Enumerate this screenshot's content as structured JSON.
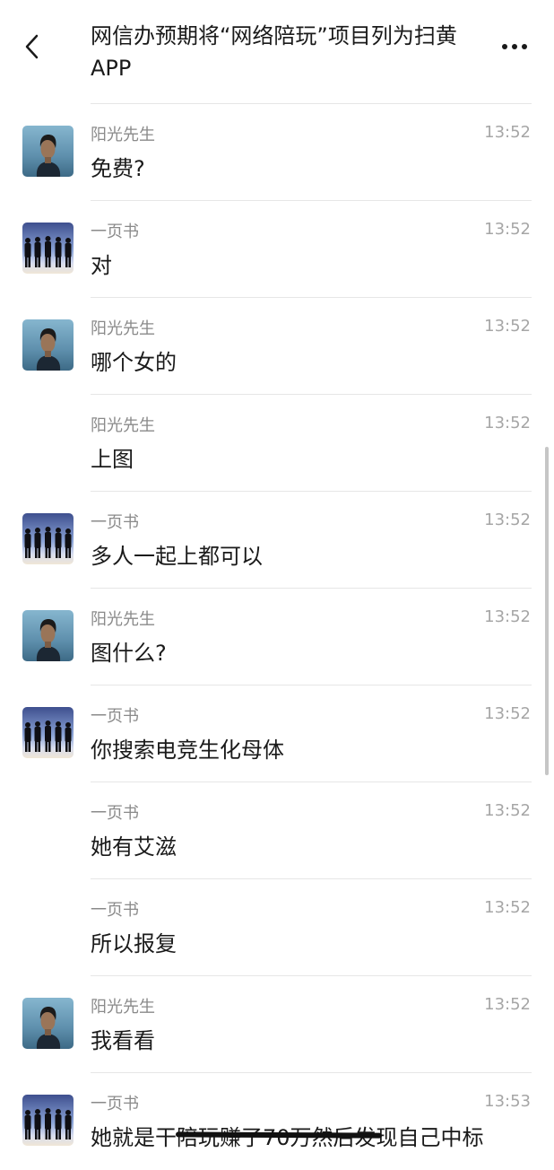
{
  "header": {
    "back_icon": "chevron-left-icon",
    "title": "网信办预期将“网络陪玩”项目列为扫黄APP",
    "more_icon": "more-horizontal-icon"
  },
  "messages": [
    {
      "sender": "阳光先生",
      "time": "13:52",
      "text": "免费?",
      "avatar": "man-avatar"
    },
    {
      "sender": "一页书",
      "time": "13:52",
      "text": "对",
      "avatar": "silhouettes-avatar"
    },
    {
      "sender": "阳光先生",
      "time": "13:52",
      "text": "哪个女的",
      "avatar": "man-avatar"
    },
    {
      "sender": "阳光先生",
      "time": "13:52",
      "text": "上图",
      "avatar": ""
    },
    {
      "sender": "一页书",
      "time": "13:52",
      "text": "多人一起上都可以",
      "avatar": "silhouettes-avatar"
    },
    {
      "sender": "阳光先生",
      "time": "13:52",
      "text": "图什么?",
      "avatar": "man-avatar"
    },
    {
      "sender": "一页书",
      "time": "13:52",
      "text": "你搜索电竞生化母体",
      "avatar": "silhouettes-avatar"
    },
    {
      "sender": "一页书",
      "time": "13:52",
      "text": "她有艾滋",
      "avatar": ""
    },
    {
      "sender": "一页书",
      "time": "13:52",
      "text": "所以报复",
      "avatar": ""
    },
    {
      "sender": "阳光先生",
      "time": "13:52",
      "text": "我看看",
      "avatar": "man-avatar"
    },
    {
      "sender": "一页书",
      "time": "13:53",
      "text": "她就是干陪玩赚了70万然后发现自己中标",
      "avatar": "silhouettes-avatar"
    }
  ]
}
